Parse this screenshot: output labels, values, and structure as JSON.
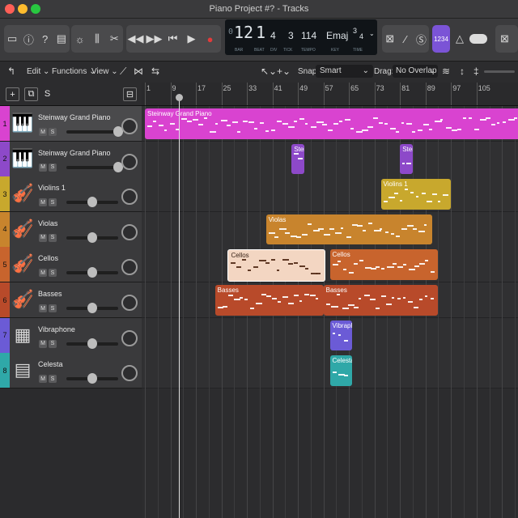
{
  "window": {
    "title": "Piano Project #? - Tracks"
  },
  "lcd": {
    "bar": "12",
    "beat": "1",
    "div": "4",
    "tick": "3",
    "tempo": "114",
    "key": "Emaj",
    "time_num": "3",
    "time_den": "4",
    "labels": {
      "bar": "BAR",
      "beat": "BEAT",
      "div": "DIV",
      "tick": "TICK",
      "tempo": "TEMPO",
      "key": "KEY",
      "time": "TIME"
    }
  },
  "toolbar": {
    "count_in_label": "1234"
  },
  "editbar": {
    "edit": "Edit",
    "functions": "Functions",
    "view": "View",
    "snap_label": "Snap:",
    "snap_value": "Smart",
    "drag_label": "Drag:",
    "drag_value": "No Overlap"
  },
  "ruler": {
    "bars": [
      "1",
      "9",
      "17",
      "25",
      "33",
      "41",
      "49",
      "57",
      "65",
      "73",
      "81",
      "89",
      "97",
      "105"
    ]
  },
  "tracks": [
    {
      "num": "1",
      "name": "Steinway Grand Piano",
      "color": "#d943d0",
      "icon": "grand-piano-icon",
      "glyph": "🎹",
      "volume": 1.0
    },
    {
      "num": "2",
      "name": "Steinway Grand Piano",
      "color": "#8d49c9",
      "icon": "grand-piano-icon",
      "glyph": "🎹",
      "volume": 1.0
    },
    {
      "num": "3",
      "name": "Violins 1",
      "color": "#c8a82d",
      "icon": "violin-icon",
      "glyph": "🎻",
      "volume": 0.45
    },
    {
      "num": "4",
      "name": "Violas",
      "color": "#c8842d",
      "icon": "violin-icon",
      "glyph": "🎻",
      "volume": 0.45
    },
    {
      "num": "5",
      "name": "Cellos",
      "color": "#c8642d",
      "icon": "cello-icon",
      "glyph": "🎻",
      "volume": 0.45
    },
    {
      "num": "6",
      "name": "Basses",
      "color": "#b84a2a",
      "icon": "violin-icon",
      "glyph": "🎻",
      "volume": 0.45
    },
    {
      "num": "7",
      "name": "Vibraphone",
      "color": "#6b5bd6",
      "icon": "vibraphone-icon",
      "glyph": "▦",
      "volume": 0.45
    },
    {
      "num": "8",
      "name": "Celesta",
      "color": "#2fa8a8",
      "icon": "celesta-icon",
      "glyph": "▤",
      "volume": 0.45
    }
  ],
  "regions": [
    {
      "track": 0,
      "name": "Steinway Grand Piano",
      "start": 1,
      "end": 121,
      "color": "#d943d0",
      "selected": false
    },
    {
      "track": 1,
      "name": "Steinway Grand Piano",
      "start": 47,
      "end": 51,
      "color": "#8d49c9",
      "selected": false
    },
    {
      "track": 1,
      "name": "Steinway Grand Piano",
      "start": 81,
      "end": 85,
      "color": "#8d49c9",
      "selected": false
    },
    {
      "track": 2,
      "name": "Violins 1",
      "start": 75,
      "end": 97,
      "color": "#c8a82d",
      "selected": false
    },
    {
      "track": 3,
      "name": "Violas",
      "start": 39,
      "end": 91,
      "color": "#c8842d",
      "selected": false
    },
    {
      "track": 4,
      "name": "Cellos",
      "start": 27,
      "end": 57,
      "color": "#f3d6c2",
      "selected": true
    },
    {
      "track": 4,
      "name": "Cellos",
      "start": 59,
      "end": 93,
      "color": "#c8642d",
      "selected": false
    },
    {
      "track": 5,
      "name": "Basses",
      "start": 23,
      "end": 57,
      "color": "#b84a2a",
      "selected": false
    },
    {
      "track": 5,
      "name": "Basses",
      "start": 57,
      "end": 93,
      "color": "#b84a2a",
      "selected": false
    },
    {
      "track": 6,
      "name": "Vibraphone",
      "start": 59,
      "end": 66,
      "color": "#6b5bd6",
      "selected": false
    },
    {
      "track": 7,
      "name": "Celesta",
      "start": 59,
      "end": 66,
      "color": "#2fa8a8",
      "selected": false
    }
  ]
}
